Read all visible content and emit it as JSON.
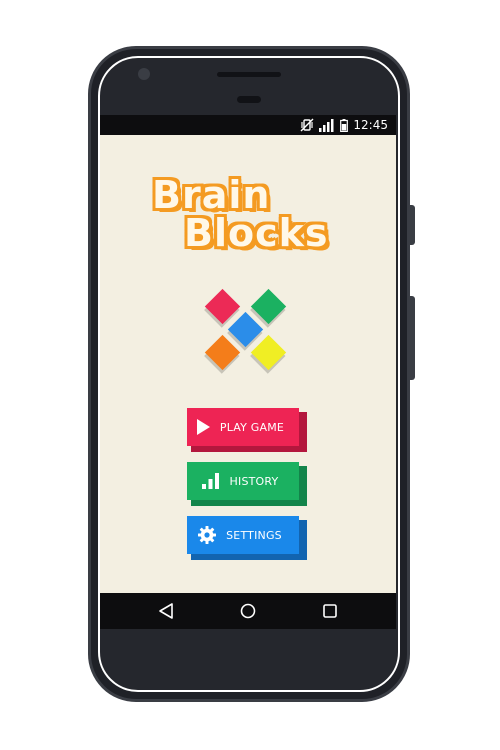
{
  "status_bar": {
    "time": "12:45",
    "icons": [
      "vibrate-off-icon",
      "signal-icon",
      "battery-icon"
    ]
  },
  "app": {
    "title_line1": "Brain",
    "title_line2": "Blocks",
    "title_color": "#fff8e8",
    "title_outline": "#f49b22",
    "logo_colors": {
      "top_left": "#ec2a56",
      "top_right": "#1bb161",
      "center": "#2b8de9",
      "bottom_left": "#f47d1a",
      "bottom_right": "#f0ee24"
    }
  },
  "menu": {
    "play": {
      "label": "PLAY GAME",
      "icon": "play-icon",
      "color": "#ee2454"
    },
    "history": {
      "label": "HISTORY",
      "icon": "bar-chart-icon",
      "color": "#1bb161"
    },
    "settings": {
      "label": "SETTINGS",
      "icon": "gear-icon",
      "color": "#1a88ea"
    }
  },
  "nav": {
    "icons": [
      "back-icon",
      "home-icon",
      "recents-icon"
    ]
  },
  "colors": {
    "screen_background": "#f3efe1",
    "phone_body": "#1f2127"
  }
}
